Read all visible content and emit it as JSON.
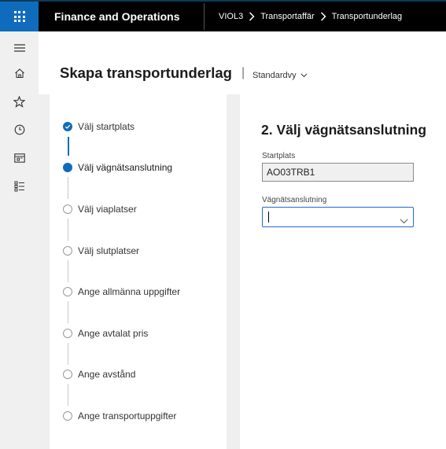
{
  "topbar": {
    "app_title": "Finance and Operations",
    "breadcrumb": [
      "VIOL3",
      "Transportaffär",
      "Transportunderlag"
    ],
    "colors": {
      "bar": "#000000",
      "waffle": "#0f6cbd"
    }
  },
  "navrail": {
    "icons": [
      "hamburger-icon",
      "home-icon",
      "star-icon",
      "clock-icon",
      "workspace-icon",
      "list-icon"
    ]
  },
  "header": {
    "page_title": "Skapa transportunderlag",
    "divider": "|",
    "view_label": "Standardvy"
  },
  "steps": [
    {
      "label": "Välj startplats",
      "state": "done"
    },
    {
      "label": "Välj vägnätsanslutning",
      "state": "current"
    },
    {
      "label": "Välj viaplatser",
      "state": "pending"
    },
    {
      "label": "Välj slutplatser",
      "state": "pending"
    },
    {
      "label": "Ange allmänna uppgifter",
      "state": "pending"
    },
    {
      "label": "Ange avtalat pris",
      "state": "pending"
    },
    {
      "label": "Ange avstånd",
      "state": "pending"
    },
    {
      "label": "Ange transportuppgifter",
      "state": "pending"
    }
  ],
  "form": {
    "section_title": "2. Välj vägnätsanslutning",
    "startplats": {
      "label": "Startplats",
      "value": "AO03TRB1"
    },
    "vagnatsanslutning": {
      "label": "Vägnätsanslutning",
      "value": ""
    }
  },
  "colors": {
    "accent": "#0f6cbd",
    "content_bg": "#efefef"
  }
}
